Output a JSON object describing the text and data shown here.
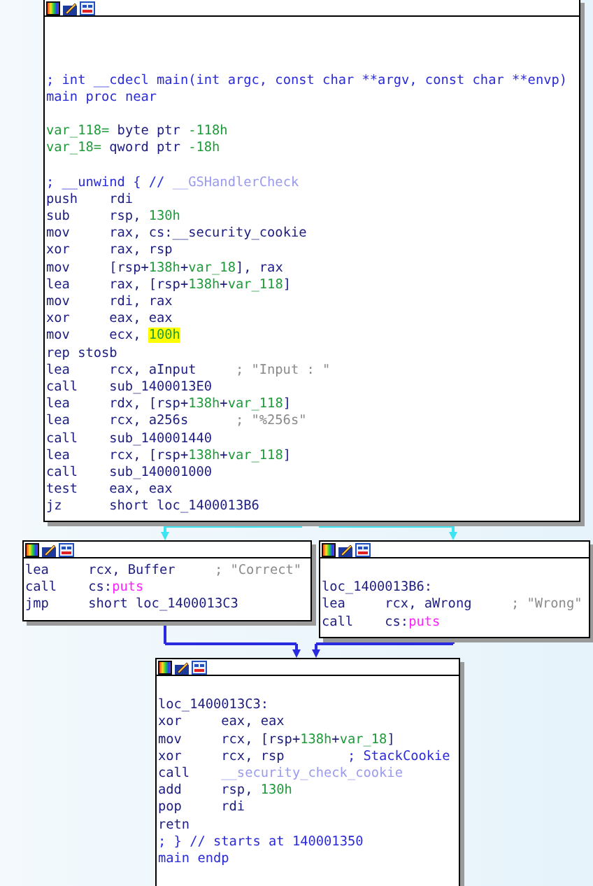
{
  "nodes": [
    {
      "lines": [
        {
          "kind": "blank"
        },
        {
          "kind": "blank"
        },
        {
          "kind": "blank"
        },
        {
          "kind": "text",
          "tokens": [
            {
              "text": "; int __cdecl main(int argc, const char **argv, const char **envp)",
              "kind": "autocomment"
            }
          ]
        },
        {
          "kind": "text",
          "tokens": [
            {
              "text": "main proc near",
              "kind": "autocomment"
            }
          ]
        },
        {
          "kind": "blank"
        },
        {
          "kind": "text",
          "tokens": [
            {
              "text": "var_118=",
              "kind": "var"
            },
            {
              "text": " byte ptr ",
              "kind": "code"
            },
            {
              "text": "-118h",
              "kind": "number"
            }
          ]
        },
        {
          "kind": "text",
          "tokens": [
            {
              "text": "var_18=",
              "kind": "var"
            },
            {
              "text": " qword ptr ",
              "kind": "code"
            },
            {
              "text": "-18h",
              "kind": "number"
            }
          ]
        },
        {
          "kind": "blank"
        },
        {
          "kind": "text",
          "tokens": [
            {
              "text": "; __unwind { // ",
              "kind": "autocomment"
            },
            {
              "text": "__GSHandlerCheck",
              "kind": "libfunc"
            }
          ]
        },
        {
          "kind": "instr",
          "mnemonic": "push",
          "operands": [
            {
              "text": "rdi",
              "kind": "code"
            }
          ]
        },
        {
          "kind": "instr",
          "mnemonic": "sub",
          "operands": [
            {
              "text": "rsp, ",
              "kind": "code"
            },
            {
              "text": "130h",
              "kind": "number"
            }
          ]
        },
        {
          "kind": "instr",
          "mnemonic": "mov",
          "operands": [
            {
              "text": "rax, cs:__security_cookie",
              "kind": "code"
            }
          ]
        },
        {
          "kind": "instr",
          "mnemonic": "xor",
          "operands": [
            {
              "text": "rax, rsp",
              "kind": "code"
            }
          ]
        },
        {
          "kind": "instr",
          "mnemonic": "mov",
          "operands": [
            {
              "text": "[rsp+",
              "kind": "code"
            },
            {
              "text": "138h",
              "kind": "number"
            },
            {
              "text": "+",
              "kind": "code"
            },
            {
              "text": "var_18",
              "kind": "var"
            },
            {
              "text": "], rax",
              "kind": "code"
            }
          ]
        },
        {
          "kind": "instr",
          "mnemonic": "lea",
          "operands": [
            {
              "text": "rax, [rsp+",
              "kind": "code"
            },
            {
              "text": "138h",
              "kind": "number"
            },
            {
              "text": "+",
              "kind": "code"
            },
            {
              "text": "var_118",
              "kind": "var"
            },
            {
              "text": "]",
              "kind": "code"
            }
          ]
        },
        {
          "kind": "instr",
          "mnemonic": "mov",
          "operands": [
            {
              "text": "rdi, rax",
              "kind": "code"
            }
          ]
        },
        {
          "kind": "instr",
          "mnemonic": "xor",
          "operands": [
            {
              "text": "eax, eax",
              "kind": "code"
            }
          ]
        },
        {
          "kind": "instr",
          "mnemonic": "mov",
          "operands": [
            {
              "text": "ecx, ",
              "kind": "code"
            },
            {
              "text": "100h",
              "kind": "number",
              "highlighted": true
            }
          ]
        },
        {
          "kind": "text",
          "tokens": [
            {
              "text": "rep stosb",
              "kind": "code"
            }
          ]
        },
        {
          "kind": "instr",
          "mnemonic": "lea",
          "operands": [
            {
              "text": "rcx, aInput",
              "kind": "code"
            }
          ],
          "comment": {
            "text": "; \"Input : \"",
            "kind": "comment"
          }
        },
        {
          "kind": "instr",
          "mnemonic": "call",
          "operands": [
            {
              "text": "sub_1400013E0",
              "kind": "code"
            }
          ]
        },
        {
          "kind": "instr",
          "mnemonic": "lea",
          "operands": [
            {
              "text": "rdx, [rsp+",
              "kind": "code"
            },
            {
              "text": "138h",
              "kind": "number"
            },
            {
              "text": "+",
              "kind": "code"
            },
            {
              "text": "var_118",
              "kind": "var"
            },
            {
              "text": "]",
              "kind": "code"
            }
          ]
        },
        {
          "kind": "instr",
          "mnemonic": "lea",
          "operands": [
            {
              "text": "rcx, a256s",
              "kind": "code"
            }
          ],
          "comment": {
            "text": "; \"%256s\"",
            "kind": "comment"
          }
        },
        {
          "kind": "instr",
          "mnemonic": "call",
          "operands": [
            {
              "text": "sub_140001440",
              "kind": "code"
            }
          ]
        },
        {
          "kind": "instr",
          "mnemonic": "lea",
          "operands": [
            {
              "text": "rcx, [rsp+",
              "kind": "code"
            },
            {
              "text": "138h",
              "kind": "number"
            },
            {
              "text": "+",
              "kind": "code"
            },
            {
              "text": "var_118",
              "kind": "var"
            },
            {
              "text": "]",
              "kind": "code"
            }
          ]
        },
        {
          "kind": "instr",
          "mnemonic": "call",
          "operands": [
            {
              "text": "sub_140001000",
              "kind": "code"
            }
          ]
        },
        {
          "kind": "instr",
          "mnemonic": "test",
          "operands": [
            {
              "text": "eax, eax",
              "kind": "code"
            }
          ]
        },
        {
          "kind": "instr",
          "mnemonic": "jz",
          "operands": [
            {
              "text": "short loc_1400013B6",
              "kind": "code"
            }
          ]
        }
      ]
    },
    {
      "lines": [
        {
          "kind": "instr",
          "mnemonic": "lea",
          "operands": [
            {
              "text": "rcx, Buffer",
              "kind": "code"
            }
          ],
          "comment": {
            "text": "; \"Correct\"",
            "kind": "comment"
          }
        },
        {
          "kind": "instr",
          "mnemonic": "call",
          "operands": [
            {
              "text": "cs:",
              "kind": "code"
            },
            {
              "text": "puts",
              "kind": "func"
            }
          ]
        },
        {
          "kind": "instr",
          "mnemonic": "jmp",
          "operands": [
            {
              "text": "short loc_1400013C3",
              "kind": "code"
            }
          ]
        }
      ]
    },
    {
      "lines": [
        {
          "kind": "blank"
        },
        {
          "kind": "text",
          "tokens": [
            {
              "text": "loc_1400013B6:",
              "kind": "code"
            }
          ]
        },
        {
          "kind": "instr",
          "mnemonic": "lea",
          "operands": [
            {
              "text": "rcx, aWrong",
              "kind": "code"
            }
          ],
          "comment": {
            "text": "; \"Wrong\"",
            "kind": "comment"
          }
        },
        {
          "kind": "instr",
          "mnemonic": "call",
          "operands": [
            {
              "text": "cs:",
              "kind": "code"
            },
            {
              "text": "puts",
              "kind": "func"
            }
          ]
        }
      ]
    },
    {
      "lines": [
        {
          "kind": "blank"
        },
        {
          "kind": "text",
          "tokens": [
            {
              "text": "loc_1400013C3:",
              "kind": "code"
            }
          ]
        },
        {
          "kind": "instr",
          "mnemonic": "xor",
          "operands": [
            {
              "text": "eax, eax",
              "kind": "code"
            }
          ]
        },
        {
          "kind": "instr",
          "mnemonic": "mov",
          "operands": [
            {
              "text": "rcx, [rsp+",
              "kind": "code"
            },
            {
              "text": "138h",
              "kind": "number"
            },
            {
              "text": "+",
              "kind": "code"
            },
            {
              "text": "var_18",
              "kind": "var"
            },
            {
              "text": "]",
              "kind": "code"
            }
          ]
        },
        {
          "kind": "instr",
          "mnemonic": "xor",
          "operands": [
            {
              "text": "rcx, rsp",
              "kind": "code"
            }
          ],
          "comment": {
            "text": "; StackCookie",
            "kind": "autocomment"
          }
        },
        {
          "kind": "instr",
          "mnemonic": "call",
          "operands": [
            {
              "text": "__security_check_cookie",
              "kind": "libfunc"
            }
          ]
        },
        {
          "kind": "instr",
          "mnemonic": "add",
          "operands": [
            {
              "text": "rsp, ",
              "kind": "code"
            },
            {
              "text": "130h",
              "kind": "number"
            }
          ]
        },
        {
          "kind": "instr",
          "mnemonic": "pop",
          "operands": [
            {
              "text": "rdi",
              "kind": "code"
            }
          ]
        },
        {
          "kind": "instr",
          "mnemonic": "retn"
        },
        {
          "kind": "text",
          "tokens": [
            {
              "text": "; } // starts at 140001350",
              "kind": "autocomment"
            }
          ]
        },
        {
          "kind": "text",
          "tokens": [
            {
              "text": "main endp",
              "kind": "autocomment"
            }
          ]
        }
      ]
    }
  ],
  "edges": [
    {
      "kind": "branch"
    },
    {
      "kind": "branch"
    },
    {
      "kind": "jump"
    },
    {
      "kind": "jump"
    }
  ]
}
